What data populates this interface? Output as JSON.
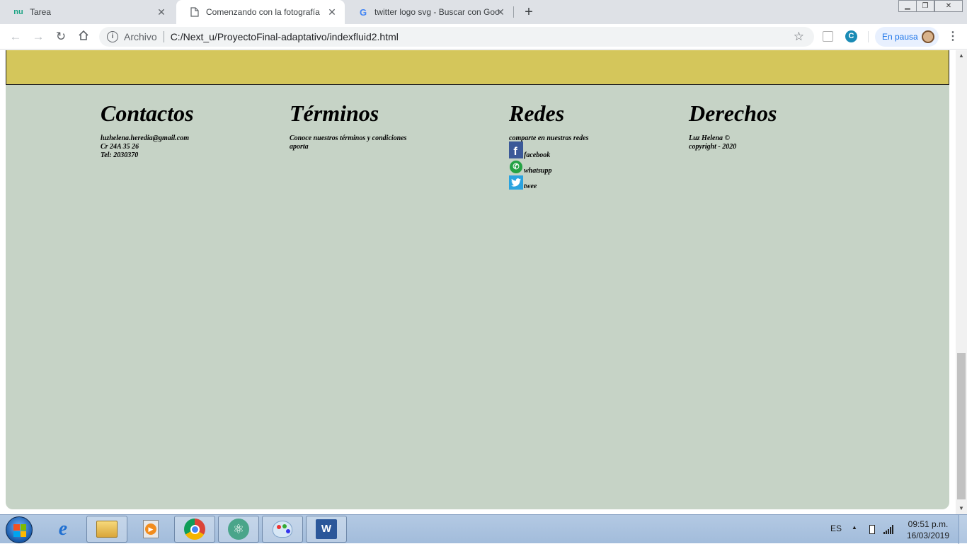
{
  "browser": {
    "tabs": [
      {
        "label": "Tarea",
        "icon": "nu-favicon",
        "icon_text": "nu"
      },
      {
        "label": "Comenzando con la fotografía",
        "icon": "document-icon"
      },
      {
        "label": "twitter logo svg - Buscar con Goo",
        "icon": "google-icon",
        "icon_text": "G"
      }
    ],
    "new_tab_label": "+",
    "address": {
      "chip": "Archivo",
      "url": "C:/Next_u/ProyectoFinal-adaptativo/indexfluid2.html"
    },
    "profile_label": "En pausa"
  },
  "page": {
    "columns": {
      "contactos": {
        "title": "Contactos",
        "lines": [
          "luzhelena.heredia@gmail.com",
          "Cr 24A 35 26",
          "Tel: 2030370"
        ]
      },
      "terminos": {
        "title": "Términos",
        "lines": [
          "Conoce nuestros términos y condiciones",
          "aporta"
        ]
      },
      "redes": {
        "title": "Redes",
        "intro": "comparte en nuestras redes",
        "links": [
          {
            "label": "facebook",
            "icon": "facebook-icon",
            "glyph": "f"
          },
          {
            "label": "whatsupp",
            "icon": "whatsapp-icon",
            "glyph": "✆"
          },
          {
            "label": "twee",
            "icon": "twitter-icon",
            "glyph": "🐦"
          }
        ]
      },
      "derechos": {
        "title": "Derechos",
        "lines": [
          "Luz Helena ©",
          "copyright - 2020"
        ]
      }
    },
    "colors": {
      "band": "#d4c65b",
      "footer": "#c6d3c6"
    }
  },
  "taskbar": {
    "language": "ES",
    "time": "09:51 p.m.",
    "date": "16/03/2019",
    "apps": [
      "internet-explorer",
      "file-explorer",
      "media-player",
      "chrome",
      "atom",
      "paint",
      "word"
    ],
    "word_glyph": "W"
  }
}
